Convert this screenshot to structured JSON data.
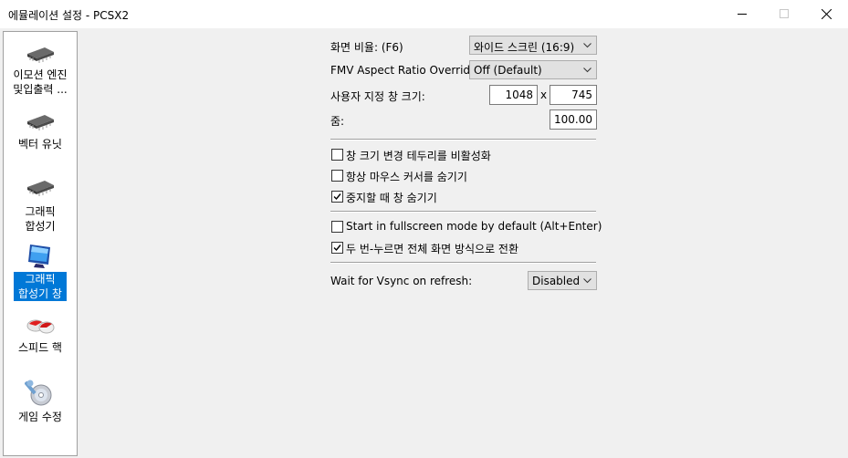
{
  "window": {
    "title": "에뮬레이션 설정 - PCSX2"
  },
  "sidebar": {
    "items": [
      {
        "label_line1": "이모션 엔진",
        "label_line2": "및입출력 ...",
        "icon": "chip-icon",
        "selected": false
      },
      {
        "label_line1": "벡터 유닛",
        "label_line2": "",
        "icon": "chip-icon",
        "selected": false
      },
      {
        "label_line1": "그래픽",
        "label_line2": "합성기",
        "icon": "chip-icon",
        "selected": false
      },
      {
        "label_line1": "그래픽",
        "label_line2": "합성기 창",
        "icon": "monitor-icon",
        "selected": true
      },
      {
        "label_line1": "스피드 핵",
        "label_line2": "",
        "icon": "pills-icon",
        "selected": false
      },
      {
        "label_line1": "게임 수정",
        "label_line2": "",
        "icon": "disc-wrench-icon",
        "selected": false
      }
    ]
  },
  "form": {
    "aspect_label": "화면 비율: (F6)",
    "aspect_value": "와이드 스크린 (16:9)",
    "fmv_label": "FMV Aspect Ratio Override:",
    "fmv_value": "Off (Default)",
    "custom_size_label": "사용자 지정 창 크기:",
    "width_value": "1048",
    "size_separator": "x",
    "height_value": "745",
    "zoom_label": "줌:",
    "zoom_value": "100.00",
    "checkboxes_group1": [
      {
        "label": "창 크기 변경 테두리를 비활성화",
        "checked": false
      },
      {
        "label": "항상 마우스 커서를 숨기기",
        "checked": false
      },
      {
        "label": "중지할 때 창 숨기기",
        "checked": true
      }
    ],
    "checkboxes_group2": [
      {
        "label": "Start in fullscreen mode by default (Alt+Enter)",
        "checked": false
      },
      {
        "label": "두 번-누르면 전체 화면 방식으로 전환",
        "checked": true
      }
    ],
    "vsync_label": "Wait for Vsync on refresh:",
    "vsync_value": "Disabled"
  },
  "colors": {
    "selection": "#0078d7",
    "window_bg": "#f0f0f0"
  }
}
